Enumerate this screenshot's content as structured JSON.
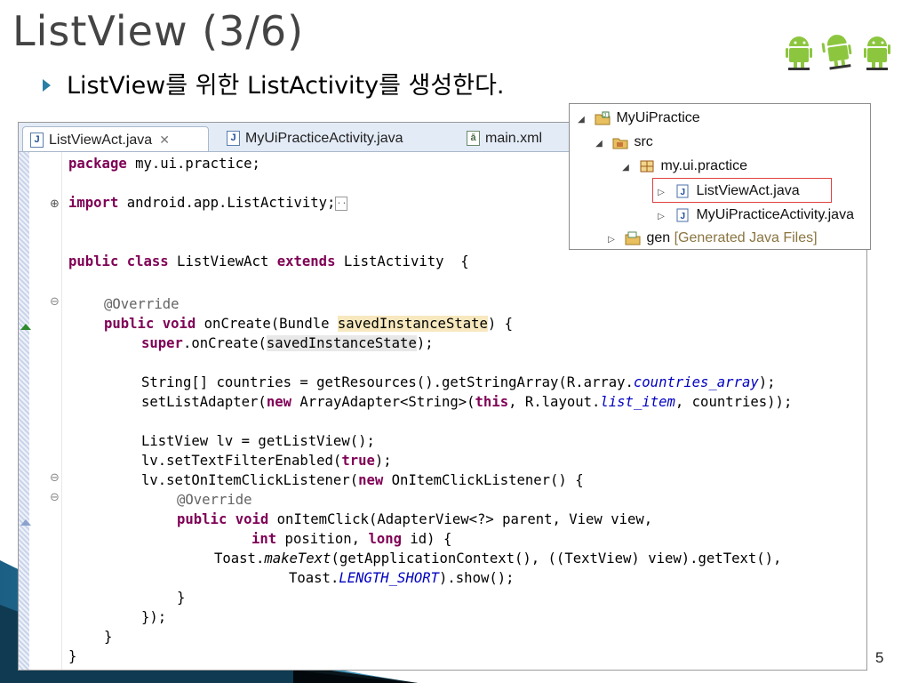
{
  "slide": {
    "title": "ListView (3/6)",
    "bullet": "ListView를 위한 ListActivity를 생성한다.",
    "page_number": "5"
  },
  "editor": {
    "tabs": [
      {
        "label": "ListViewAct.java",
        "icon": "java-file-icon",
        "active": true,
        "close": "✕"
      },
      {
        "label": "MyUiPracticeActivity.java",
        "icon": "java-file-icon",
        "active": false
      },
      {
        "label": "main.xml",
        "icon": "xml-file-icon",
        "active": false
      }
    ],
    "code": {
      "l1_kw": "package",
      "l1_rest": " my.ui.practice;",
      "l2_kw": "import",
      "l2_rest": " android.app.ListActivity;",
      "l3_kw1": "public class",
      "l3_name": " ListViewAct ",
      "l3_kw2": "extends",
      "l3_rest": " ListActivity  {",
      "l4_ann": "@Override",
      "l5_kw": "public void",
      "l5_a": " onCreate(Bundle ",
      "l5_hl": "savedInstanceState",
      "l5_b": ") {",
      "l6_kw": "super",
      "l6_a": ".onCreate(",
      "l6_hl": "savedInstanceState",
      "l6_b": ");",
      "l7_a": "String[] countries = getResources().getStringArray(R.array.",
      "l7_fld": "countries_array",
      "l7_b": ");",
      "l8_a": "setListAdapter(",
      "l8_kw": "new",
      "l8_b": " ArrayAdapter<String>(",
      "l8_kw2": "this",
      "l8_c": ", R.layout.",
      "l8_fld": "list_item",
      "l8_d": ", countries));",
      "l9": "ListView lv = getListView();",
      "l10_a": "lv.setTextFilterEnabled(",
      "l10_kw": "true",
      "l10_b": ");",
      "l11_a": "lv.setOnItemClickListener(",
      "l11_kw": "new",
      "l11_b": " OnItemClickListener() {",
      "l12_ann": "@Override",
      "l13_kw": "public void",
      "l13_a": " onItemClick(AdapterView<?> parent, View view,",
      "l14_kw": "int",
      "l14_a": " position, ",
      "l14_kw2": "long",
      "l14_b": " id) {",
      "l15_a": "Toast.",
      "l15_it": "makeText",
      "l15_b": "(getApplicationContext(), ((TextView) view).getText(),",
      "l16_a": "Toast.",
      "l16_fld": "LENGTH_SHORT",
      "l16_b": ").show();",
      "l17": "}",
      "l18": "});",
      "l19": "}",
      "l20": "}"
    }
  },
  "explorer": {
    "project": "MyUiPractice",
    "src": "src",
    "package": "my.ui.practice",
    "file1": "ListViewAct.java",
    "file2": "MyUiPracticeActivity.java",
    "gen": "gen",
    "gen_note": "[Generated Java Files]"
  },
  "colors": {
    "keyword": "#7f0055",
    "field": "#0000c0",
    "annotation": "#646464",
    "highlight": "#f7e8bf",
    "selection_border": "#e04040",
    "android_green": "#8cc63f"
  }
}
